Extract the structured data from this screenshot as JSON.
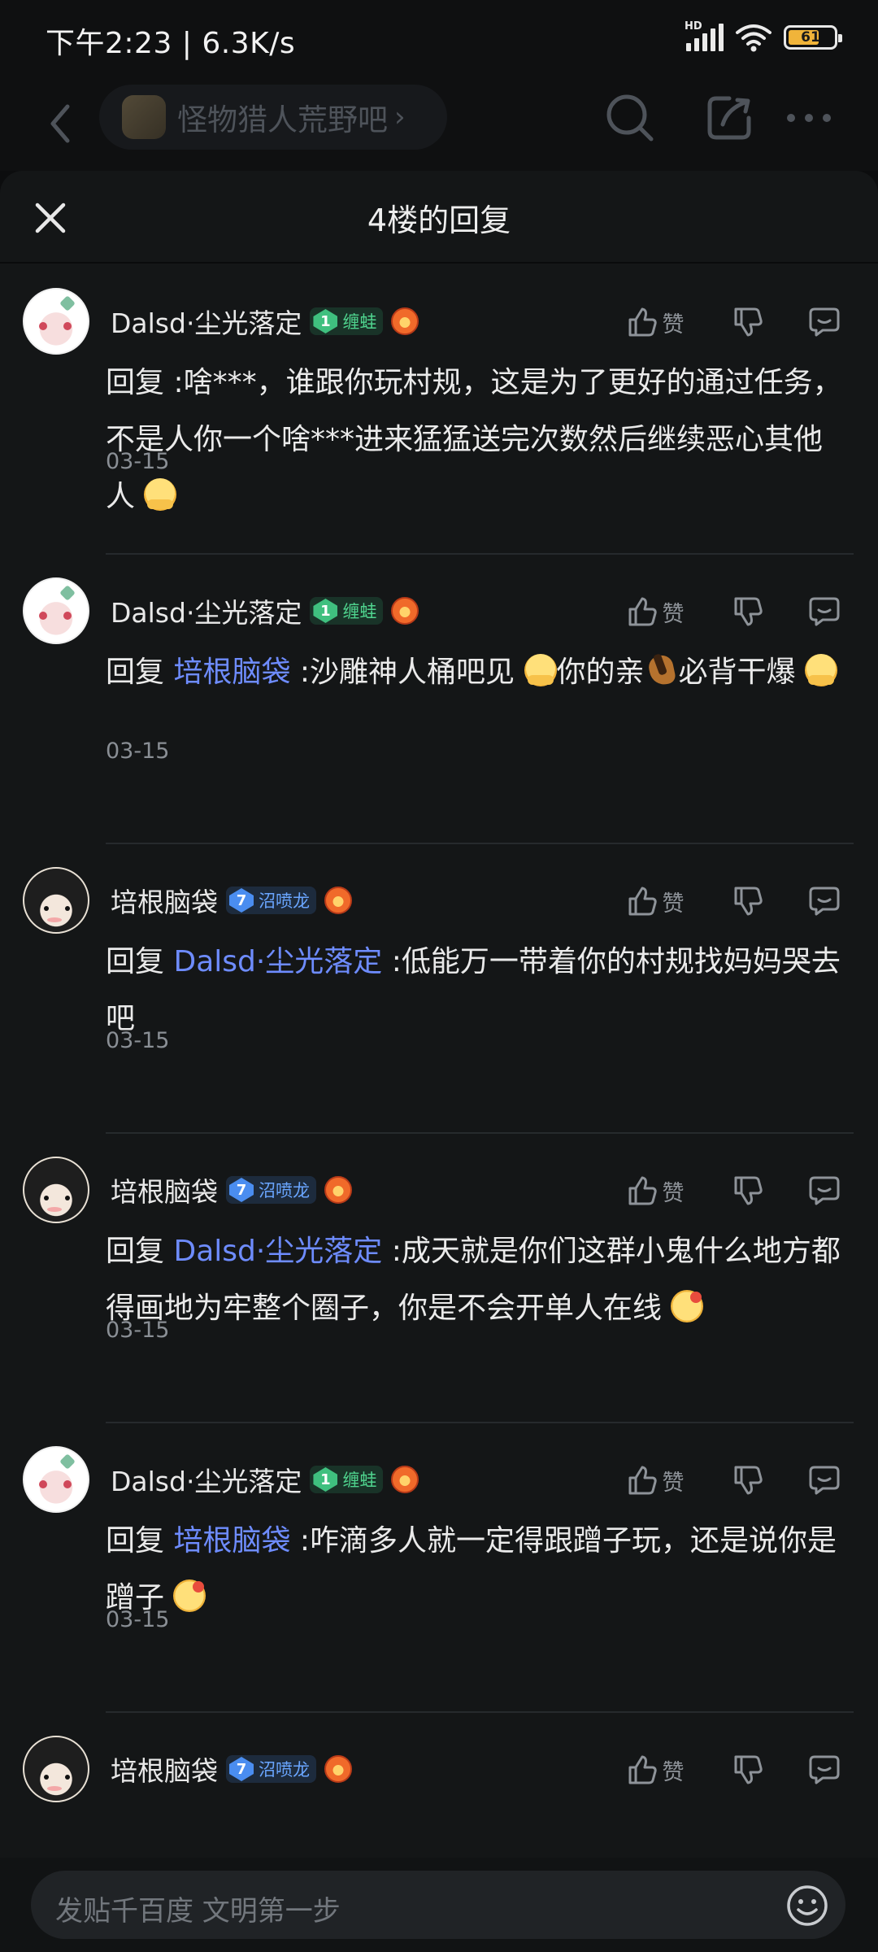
{
  "status_bar": {
    "time": "下午2:23 | 6.3K/s",
    "network_label": "HD",
    "battery_level": "61"
  },
  "top_nav": {
    "forum_name": "怪物猎人荒野吧",
    "forum_chevron": "›"
  },
  "sheet": {
    "title": "4楼的回复"
  },
  "actions": {
    "like_label": "赞"
  },
  "replies": [
    {
      "author": "Dalsd·尘光落定",
      "level": "1",
      "badge_title": "缠蛙",
      "badge_color": "green",
      "reply_prefix": "回复",
      "mention": "",
      "text": " :啥***，谁跟你玩村规，这是为了更好的通过任务，不是人你一个啥***进来猛猛送完次数然后继续恶心其他人 ",
      "emoji": "hug",
      "date": "03-15"
    },
    {
      "author": "Dalsd·尘光落定",
      "level": "1",
      "badge_title": "缠蛙",
      "badge_color": "green",
      "reply_prefix": "回复",
      "mention": "培根脑袋",
      "text_a": " :沙雕神人桶吧见 ",
      "text_b": "你的亲",
      "text_c": "必背干爆 ",
      "date": "03-15"
    },
    {
      "author": "培根脑袋",
      "level": "7",
      "badge_title": "沼喷龙",
      "badge_color": "blue",
      "reply_prefix": "回复",
      "mention": "Dalsd·尘光落定",
      "text": " :低能万一带着你的村规找妈妈哭去吧",
      "date": "03-15"
    },
    {
      "author": "培根脑袋",
      "level": "7",
      "badge_title": "沼喷龙",
      "badge_color": "blue",
      "reply_prefix": "回复",
      "mention": "Dalsd·尘光落定",
      "text": " :成天就是你们这群小鬼什么地方都得画地为牢整个圈子，你是不会开单人在线 ",
      "emoji": "wink",
      "date": "03-15"
    },
    {
      "author": "Dalsd·尘光落定",
      "level": "1",
      "badge_title": "缠蛙",
      "badge_color": "green",
      "reply_prefix": "回复",
      "mention": "培根脑袋",
      "text": " :咋滴多人就一定得跟蹭子玩，还是说你是蹭子 ",
      "emoji": "wink",
      "date": "03-15"
    },
    {
      "author": "培根脑袋",
      "level": "7",
      "badge_title": "沼喷龙",
      "badge_color": "blue"
    }
  ],
  "input_bar": {
    "placeholder": "发贴千百度 文明第一步"
  },
  "colors": {
    "background": "#141617",
    "mention": "#6e8cff",
    "badge_green": "#3fc07f",
    "badge_blue": "#4a8df0"
  }
}
